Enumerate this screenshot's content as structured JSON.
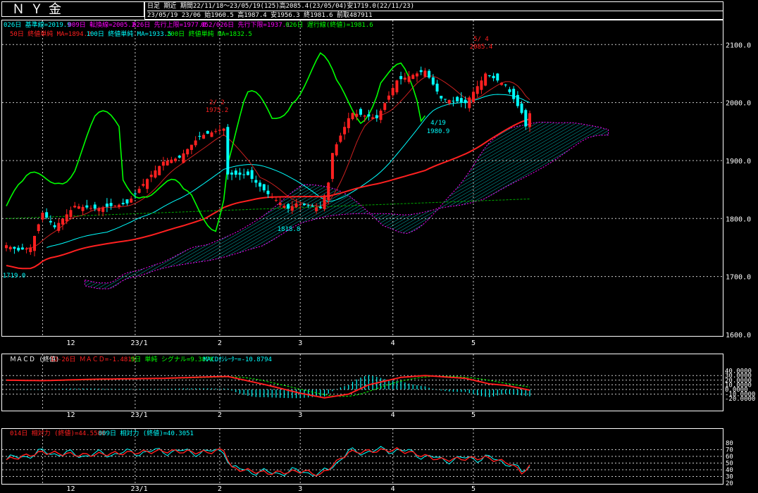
{
  "header": {
    "instrument": "ＮＹ金",
    "line1": "日足 期近 期間22/11/18～23/05/19(125)高2085.4(23/05/04)安1719.0(22/11/23)",
    "line2": "23/05/19 23/06 始1960.5 高1987.4 安1956.3 終1981.6 前取487911"
  },
  "legends": {
    "main_line1": [
      {
        "text": "026日 基準線=2019.9",
        "color": "#00ffff"
      },
      {
        "text": "009日 転換線=2005.2",
        "color": "#ff00ff"
      },
      {
        "text": "026日 先行上限=1977.0",
        "color": "#ff00ff"
      },
      {
        "text": "052/026日 先行下限=1937.1",
        "color": "#ff00ff"
      },
      {
        "text": "026日 遅行線(終値)=1981.6",
        "color": "#00ff00"
      }
    ],
    "main_line2": [
      {
        "text": "50日 終値単純 MA=1894.2",
        "color": "#ff2020"
      },
      {
        "text": "100日 終値単純 MA=1933.5",
        "color": "#00ffff"
      },
      {
        "text": "200日 終値単純 MA=1832.5",
        "color": "#00ff00"
      }
    ],
    "macd": [
      {
        "text": "ＭＡＣＤ (終値)",
        "color": "#ffffff"
      },
      {
        "text": "12-26日 ＭＡＣＤ=-1.4815",
        "color": "#ff2020"
      },
      {
        "text": "9日 単純 シグナル=9.3879",
        "color": "#00ff00"
      },
      {
        "text": "MACDｵｼﾚｰﾀｰ=-10.8794",
        "color": "#00ffff"
      }
    ],
    "rsi": [
      {
        "text": "014日 相対力 (終値)=44.5580",
        "color": "#ff2020"
      },
      {
        "text": "009日 相対力 (終値)=40.3051",
        "color": "#00ffff"
      }
    ]
  },
  "annotations": {
    "high_main": {
      "date": "5/ 4",
      "value": "2085.4"
    },
    "feb_high": {
      "date": "2/ 2",
      "value": "1975.2"
    },
    "apr_low": {
      "date": "4/19",
      "value": "1980.9"
    },
    "mar_low": {
      "value": "1818.8"
    },
    "nov_low": {
      "value": "1719.0"
    }
  },
  "x_tick_labels": [
    "12",
    "23/1",
    "2",
    "3",
    "4",
    "5"
  ],
  "chart_data": {
    "type": "candlestick",
    "title": "ＮＹ金",
    "period": "22/11/18～23/05/19",
    "price_axis": {
      "ticks": [
        "2100.0",
        "2000.0",
        "1900.0",
        "1800.0",
        "1700.0",
        "1600.0"
      ],
      "ylim": [
        1600,
        2110
      ]
    },
    "macd_axis": {
      "ticks": [
        "40.0000",
        "30.0000",
        "20.0000",
        "10.0000",
        "0.0000",
        "-10.0000",
        "-20.0000"
      ],
      "ylim": [
        -20,
        40
      ]
    },
    "rsi_axis": {
      "ticks": [
        "80",
        "70",
        "60",
        "50",
        "40",
        "30",
        "20"
      ],
      "ylim": [
        20,
        80
      ]
    },
    "close_anchors": [
      [
        "22/11/18",
        1754
      ],
      [
        "22/11/23",
        1745
      ],
      [
        "22/11/28",
        1750
      ],
      [
        "22/12/01",
        1810
      ],
      [
        "22/12/06",
        1785
      ],
      [
        "22/12/13",
        1822
      ],
      [
        "22/12/20",
        1817
      ],
      [
        "22/12/30",
        1826
      ],
      [
        "23/01/06",
        1868
      ],
      [
        "23/01/12",
        1898
      ],
      [
        "23/01/18",
        1905
      ],
      [
        "23/01/25",
        1942
      ],
      [
        "23/02/02",
        1955
      ],
      [
        "23/02/03",
        1876
      ],
      [
        "23/02/10",
        1875
      ],
      [
        "23/02/17",
        1842
      ],
      [
        "23/02/24",
        1817
      ],
      [
        "23/02/28",
        1826
      ],
      [
        "23/03/08",
        1818
      ],
      [
        "23/03/10",
        1862
      ],
      [
        "23/03/13",
        1913
      ],
      [
        "23/03/17",
        1973
      ],
      [
        "23/03/20",
        1982
      ],
      [
        "23/03/28",
        1973
      ],
      [
        "23/04/04",
        2038
      ],
      [
        "23/04/13",
        2055
      ],
      [
        "23/04/19",
        2007
      ],
      [
        "23/04/27",
        1999
      ],
      [
        "23/05/03",
        2038
      ],
      [
        "23/05/04",
        2050
      ],
      [
        "23/05/11",
        2030
      ],
      [
        "23/05/17",
        1982
      ],
      [
        "23/05/18",
        1959
      ],
      [
        "23/05/19",
        1981.6
      ]
    ],
    "macd_anchors": [
      [
        "22/11/18",
        20
      ],
      [
        "22/12/01",
        19
      ],
      [
        "22/12/20",
        22
      ],
      [
        "23/01/12",
        24
      ],
      [
        "23/01/27",
        27
      ],
      [
        "23/02/03",
        28
      ],
      [
        "23/02/17",
        9
      ],
      [
        "23/03/01",
        -8
      ],
      [
        "23/03/09",
        -18
      ],
      [
        "23/03/17",
        -10
      ],
      [
        "23/03/24",
        10
      ],
      [
        "23/04/05",
        26
      ],
      [
        "23/04/13",
        30
      ],
      [
        "23/04/27",
        24
      ],
      [
        "23/05/05",
        12
      ],
      [
        "23/05/11",
        9
      ],
      [
        "23/05/19",
        -1.5
      ]
    ],
    "rsi_anchors": [
      [
        "22/11/18",
        55
      ],
      [
        "22/12/01",
        66
      ],
      [
        "22/12/15",
        62
      ],
      [
        "23/01/12",
        68
      ],
      [
        "23/01/27",
        66
      ],
      [
        "23/02/02",
        70
      ],
      [
        "23/02/06",
        42
      ],
      [
        "23/02/17",
        35
      ],
      [
        "23/03/02",
        38
      ],
      [
        "23/03/08",
        32
      ],
      [
        "23/03/17",
        66
      ],
      [
        "23/04/04",
        70
      ],
      [
        "23/04/19",
        55
      ],
      [
        "23/05/04",
        58
      ],
      [
        "23/05/12",
        50
      ],
      [
        "23/05/17",
        36
      ],
      [
        "23/05/19",
        44.6
      ]
    ],
    "ma_last": {
      "ma50": 1894.2,
      "ma100": 1933.5,
      "ma200": 1832.5
    },
    "colors": {
      "up": "#ff2020",
      "down": "#00ffff",
      "ma50": "#ff2020",
      "ma100": "#00ffff",
      "ma200": "#00aa00",
      "chikou": "#00ff00",
      "cloud": "#00ffff",
      "span": "#ff00ff",
      "grid": "#ffffff"
    }
  }
}
